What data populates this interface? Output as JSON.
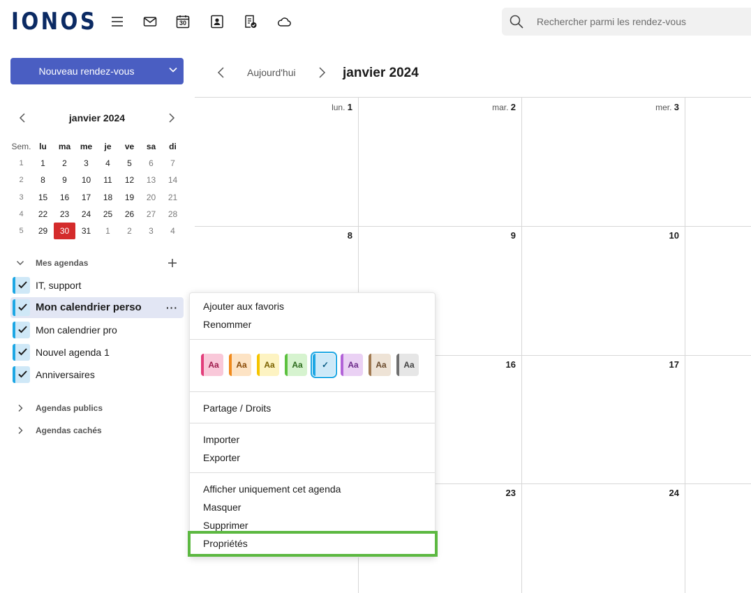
{
  "brand": {
    "logo_text": "IONOS"
  },
  "topbar": {
    "icons": [
      "menu-icon",
      "mail-icon",
      "calendar-icon",
      "contacts-icon",
      "tasks-icon",
      "cloud-icon"
    ],
    "calendar_icon_day": "30",
    "search": {
      "placeholder": "Rechercher parmi les rendez-vous"
    }
  },
  "sidebar": {
    "new_button_label": "Nouveau rendez-vous",
    "mini_calendar": {
      "title": "janvier 2024",
      "header": [
        "Sem.",
        "lu",
        "ma",
        "me",
        "je",
        "ve",
        "sa",
        "di"
      ],
      "weeks": [
        [
          "1",
          "1",
          "2",
          "3",
          "4",
          "5",
          "6",
          "7"
        ],
        [
          "2",
          "8",
          "9",
          "10",
          "11",
          "12",
          "13",
          "14"
        ],
        [
          "3",
          "15",
          "16",
          "17",
          "18",
          "19",
          "20",
          "21"
        ],
        [
          "4",
          "22",
          "23",
          "24",
          "25",
          "26",
          "27",
          "28"
        ],
        [
          "5",
          "29",
          "30",
          "31",
          "1",
          "2",
          "3",
          "4"
        ]
      ],
      "today": "30"
    },
    "my_calendars_label": "Mes agendas",
    "calendars": [
      {
        "name": "IT, support",
        "active": false
      },
      {
        "name": "Mon calendrier perso",
        "active": true
      },
      {
        "name": "Mon calendrier pro",
        "active": false
      },
      {
        "name": "Nouvel agenda 1",
        "active": false
      },
      {
        "name": "Anniversaires",
        "active": false
      }
    ],
    "more_label": "···",
    "public_calendars_label": "Agendas publics",
    "hidden_calendars_label": "Agendas cachés"
  },
  "main": {
    "today_label": "Aujourd'hui",
    "month_title": "janvier 2024",
    "day_headers": [
      {
        "day": "lun.",
        "num": "1"
      },
      {
        "day": "mar.",
        "num": "2"
      },
      {
        "day": "mer.",
        "num": "3"
      }
    ],
    "week_dates": [
      [
        "8",
        "9",
        "10"
      ],
      [
        "",
        "16",
        "17"
      ],
      [
        "",
        "23",
        "24"
      ]
    ]
  },
  "context_menu": {
    "group1": [
      "Ajouter aux favoris",
      "Renommer"
    ],
    "swatch_label": "Aa",
    "swatches": [
      {
        "bg": "#f9c8d9",
        "border": "#e23d7a",
        "fg": "#9e1b4c"
      },
      {
        "bg": "#fde3c4",
        "border": "#f08a1c",
        "fg": "#8a4a06"
      },
      {
        "bg": "#fdf3c2",
        "border": "#f5c400",
        "fg": "#7a6100"
      },
      {
        "bg": "#d6f3cf",
        "border": "#5cc13f",
        "fg": "#2d6b1d"
      },
      {
        "bg": "#cde9f8",
        "border": "#1ea7e4",
        "fg": "#0d5f86",
        "selected": true
      },
      {
        "bg": "#ead1f4",
        "border": "#b262d8",
        "fg": "#6c2a8a"
      },
      {
        "bg": "#eee3d6",
        "border": "#a17a52",
        "fg": "#6a4a2c"
      },
      {
        "bg": "#e6e6e6",
        "border": "#6f6f6f",
        "fg": "#444444"
      }
    ],
    "check_glyph": "✓",
    "group2": [
      "Partage / Droits"
    ],
    "group3": [
      "Importer",
      "Exporter"
    ],
    "group4": [
      "Afficher uniquement cet agenda",
      "Masquer",
      "Supprimer",
      "Propriétés"
    ]
  },
  "colors": {
    "accent": "#4a5ec2",
    "today": "#d42b2b",
    "calendar_color": "#1ea7e4",
    "highlight": "#5cb841"
  }
}
